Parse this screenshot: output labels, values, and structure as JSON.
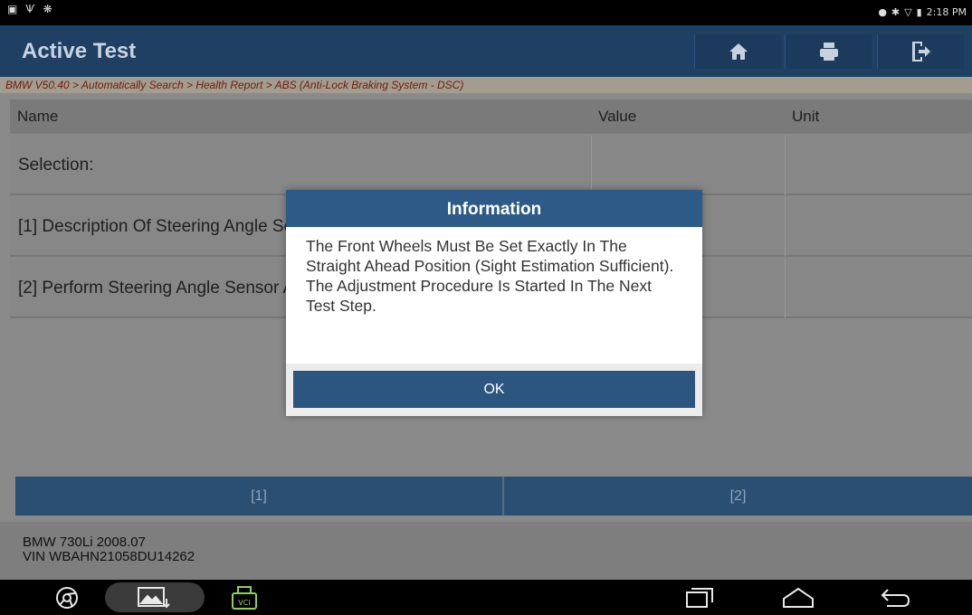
{
  "status_bar": {
    "time": "2:18 PM",
    "left_icons": [
      "screenshot-icon",
      "usb-icon",
      "settings-icon"
    ],
    "right_icons": [
      "location-icon",
      "bluetooth-icon",
      "wifi-icon",
      "battery-icon"
    ]
  },
  "header": {
    "title": "Active Test",
    "buttons": [
      "home-icon",
      "print-icon",
      "exit-icon"
    ]
  },
  "breadcrumb": "BMW V50.40 > Automatically Search > Health Report > ABS (Anti-Lock Braking System - DSC)",
  "table": {
    "columns": [
      "Name",
      "Value",
      "Unit"
    ],
    "rows": [
      {
        "name": "Selection:",
        "value": "",
        "unit": ""
      },
      {
        "name": "[1] Description Of Steering Angle Sensor Adjustment",
        "value": "",
        "unit": ""
      },
      {
        "name": "[2] Perform Steering Angle Sensor Adjustment",
        "value": "",
        "unit": ""
      }
    ]
  },
  "action_buttons": [
    "[1]",
    "[2]"
  ],
  "vehicle": {
    "model": "BMW 730Li 2008.07",
    "vin": "VIN WBAHN21058DU14262"
  },
  "dialog": {
    "title": "Information",
    "lines": [
      "The Front Wheels Must Be Set Exactly In The Straight Ahead Position (Sight Estimation Sufficient).",
      "The Adjustment Procedure Is Started In The Next Test Step."
    ],
    "ok_label": "OK"
  },
  "navbar": {
    "icons": [
      "browser-icon",
      "gallery-icon",
      "vci-icon",
      "recents-icon",
      "home-nav-icon",
      "back-icon"
    ],
    "vci_label": "VCI"
  },
  "colors": {
    "header_bg": "#1f3f63",
    "button_bg": "#2c5580",
    "breadcrumb_text": "#6f1b11"
  }
}
